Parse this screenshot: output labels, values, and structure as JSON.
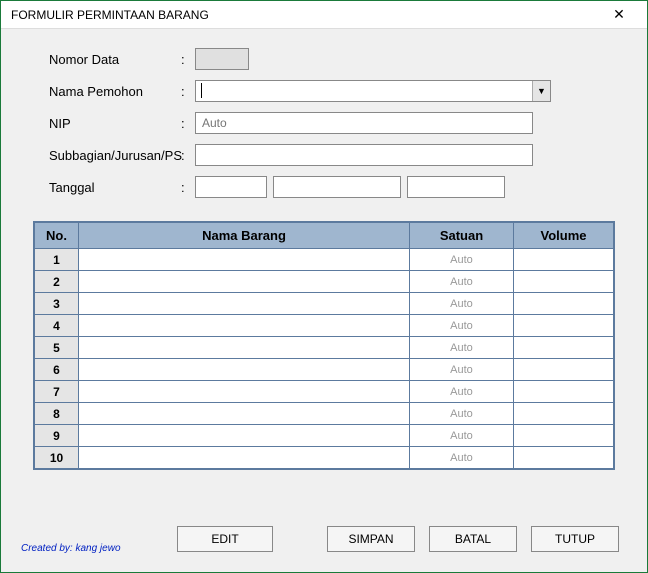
{
  "window": {
    "title": "FORMULIR PERMINTAAN BARANG"
  },
  "form": {
    "nomor_data": {
      "label": "Nomor Data",
      "value": ""
    },
    "nama_pemohon": {
      "label": "Nama Pemohon",
      "value": ""
    },
    "nip": {
      "label": "NIP",
      "placeholder": "Auto",
      "value": ""
    },
    "subbagian": {
      "label": "Subbagian/Jurusan/PS",
      "value": ""
    },
    "tanggal": {
      "label": "Tanggal",
      "v1": "",
      "v2": "",
      "v3": ""
    }
  },
  "table": {
    "headers": {
      "no": "No.",
      "nama": "Nama Barang",
      "satuan": "Satuan",
      "volume": "Volume"
    },
    "rows": [
      {
        "no": "1",
        "nama": "",
        "satuan": "Auto",
        "volume": ""
      },
      {
        "no": "2",
        "nama": "",
        "satuan": "Auto",
        "volume": ""
      },
      {
        "no": "3",
        "nama": "",
        "satuan": "Auto",
        "volume": ""
      },
      {
        "no": "4",
        "nama": "",
        "satuan": "Auto",
        "volume": ""
      },
      {
        "no": "5",
        "nama": "",
        "satuan": "Auto",
        "volume": ""
      },
      {
        "no": "6",
        "nama": "",
        "satuan": "Auto",
        "volume": ""
      },
      {
        "no": "7",
        "nama": "",
        "satuan": "Auto",
        "volume": ""
      },
      {
        "no": "8",
        "nama": "",
        "satuan": "Auto",
        "volume": ""
      },
      {
        "no": "9",
        "nama": "",
        "satuan": "Auto",
        "volume": ""
      },
      {
        "no": "10",
        "nama": "",
        "satuan": "Auto",
        "volume": ""
      }
    ]
  },
  "buttons": {
    "edit": "EDIT",
    "simpan": "SIMPAN",
    "batal": "BATAL",
    "tutup": "TUTUP"
  },
  "footer": {
    "credit": "Created by:  kang jewo"
  }
}
